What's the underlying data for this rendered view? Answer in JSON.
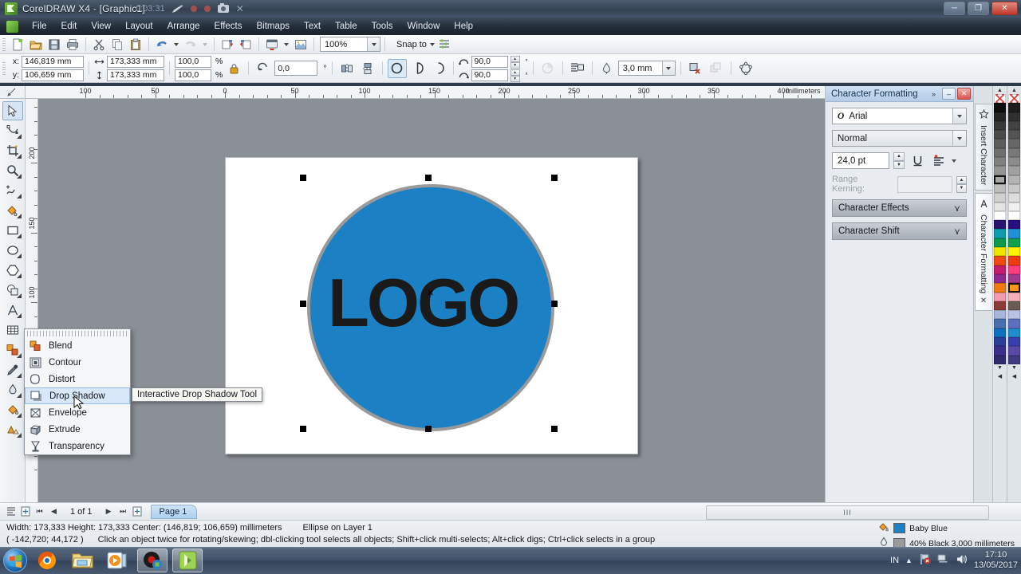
{
  "titlebar": {
    "app_title": "CorelDRAW X4 - [Graphic1]",
    "recorder_time": "0:03:31",
    "icons": [
      "pencil-icon",
      "record-dot-icon",
      "record-dot-icon",
      "camera-icon",
      "close-icon"
    ],
    "minimize": "–",
    "restore": "❐",
    "close": "✕"
  },
  "menubar": {
    "items": [
      "File",
      "Edit",
      "View",
      "Layout",
      "Arrange",
      "Effects",
      "Bitmaps",
      "Text",
      "Table",
      "Tools",
      "Window",
      "Help"
    ]
  },
  "toolbar": {
    "buttons": [
      "new-document",
      "open-document",
      "save-document",
      "print",
      "cut",
      "copy",
      "paste",
      "undo",
      "redo",
      "import",
      "export",
      "application-launcher",
      "corel-online"
    ],
    "zoom_level": "100%",
    "snap_to_label": "Snap to"
  },
  "propertybar": {
    "x_label": "x:",
    "y_label": "y:",
    "x_value": "146,819 mm",
    "y_value": "106,659 mm",
    "width_value": "173,333 mm",
    "height_value": "173,333 mm",
    "scale_h": "100,0",
    "scale_v": "100,0",
    "percent": "%",
    "lock_icon": "lock-icon",
    "rotation_value": "0,0",
    "degree": "°",
    "arc_start": "90,0",
    "arc_end": "90,0",
    "outline_width": "3,0 mm",
    "shape_modes": [
      "ellipse-mode",
      "pie-mode",
      "arc-mode"
    ]
  },
  "rulers": {
    "h_labels": [
      "100",
      "50",
      "0",
      "50",
      "100",
      "150",
      "200",
      "250",
      "300",
      "350",
      "400"
    ],
    "unit": "millimeters",
    "v_labels": [
      "200",
      "150",
      "100"
    ]
  },
  "toolbox": {
    "tools": [
      {
        "name": "pick-tool",
        "selected": true
      },
      {
        "name": "shape-tool",
        "selected": false
      },
      {
        "name": "crop-tool",
        "selected": false
      },
      {
        "name": "zoom-tool",
        "selected": false
      },
      {
        "name": "freehand-tool",
        "selected": false
      },
      {
        "name": "smart-fill-tool",
        "selected": false
      },
      {
        "name": "rectangle-tool",
        "selected": false
      },
      {
        "name": "ellipse-tool",
        "selected": false
      },
      {
        "name": "polygon-tool",
        "selected": false
      },
      {
        "name": "basic-shapes-tool",
        "selected": false
      },
      {
        "name": "text-tool",
        "selected": false
      },
      {
        "name": "table-tool",
        "selected": false
      },
      {
        "name": "interactive-blend-tool",
        "selected": false
      },
      {
        "name": "eyedropper-tool",
        "selected": false
      },
      {
        "name": "outline-tool",
        "selected": false
      },
      {
        "name": "fill-tool",
        "selected": false
      },
      {
        "name": "interactive-fill-tool",
        "selected": false
      }
    ]
  },
  "flyout": {
    "items": [
      {
        "label": "Blend",
        "icon": "blend-icon",
        "highlighted": false
      },
      {
        "label": "Contour",
        "icon": "contour-icon",
        "highlighted": false
      },
      {
        "label": "Distort",
        "icon": "distort-icon",
        "highlighted": false
      },
      {
        "label": "Drop Shadow",
        "icon": "drop-shadow-icon",
        "highlighted": true
      },
      {
        "label": "Envelope",
        "icon": "envelope-icon",
        "highlighted": false
      },
      {
        "label": "Extrude",
        "icon": "extrude-icon",
        "highlighted": false
      },
      {
        "label": "Transparency",
        "icon": "transparency-icon",
        "highlighted": false
      }
    ],
    "tooltip": "Interactive Drop Shadow Tool"
  },
  "canvas": {
    "logo_text": "LOGO",
    "circle_fill": "#1b80c4",
    "circle_outline": "#9a9a9a",
    "page_background": "#ffffff"
  },
  "docker": {
    "title": "Character Formatting",
    "collapse_icon": "»",
    "minimize_icon": "–",
    "close_icon": "✕",
    "font_family": "Arial",
    "font_style": "Normal",
    "font_size": "24,0 pt",
    "underline_icon": "underline-icon",
    "align_icon": "text-align-icon",
    "kerning_label": "Range Kerning:",
    "kerning_value": "",
    "sections": [
      "Character Effects",
      "Character Shift"
    ],
    "tabs": [
      "Insert Character",
      "Character Formatting"
    ],
    "tab_close": "✕"
  },
  "pagebar": {
    "page_counter": "1 of 1",
    "page_tab": "Page 1",
    "nav_first": "⏮",
    "nav_prev": "◀",
    "nav_next": "▶",
    "nav_last": "⏭",
    "add_page_icon": "add-page-icon"
  },
  "statusbar": {
    "dimensions": "Width: 173,333 Height: 173,333 Center: (146,819; 106,659)  millimeters",
    "object_info": "Ellipse on Layer 1",
    "coordinates": "( -142,720; 44,172 )",
    "hint": "Click an object twice for rotating/skewing; dbl-clicking tool selects all objects; Shift+click multi-selects; Alt+click digs; Ctrl+click selects in a group",
    "fill_color_name": "Baby Blue",
    "fill_color_hex": "#1b80c4",
    "outline_color_name": "40% Black  3,000 millimeters",
    "outline_color_hex": "#9a9a9a"
  },
  "taskbar": {
    "start_icon": "windows-start-icon",
    "apps": [
      "firefox-icon",
      "file-explorer-icon",
      "media-player-icon",
      "screen-recorder-icon",
      "coreldraw-icon"
    ],
    "tray_language": "IN",
    "tray_icons": [
      "show-hidden-icon",
      "flag-action-center-icon",
      "network-icon",
      "volume-icon"
    ],
    "time": "17:10",
    "date": "13/05/2017"
  },
  "palette": {
    "column1": [
      "none",
      "#0d0d0d",
      "#262626",
      "#383838",
      "#4a4a4a",
      "#5c5c5c",
      "#6e6e6e",
      "#808080",
      "#949494",
      "#a8a8a8",
      "#bcbcbc",
      "#d0d0d0",
      "#e4e4e4",
      "#ffffff",
      "#2b1370",
      "#0f9bab",
      "#0d9a4e",
      "#f2e600",
      "#ee4b13",
      "#c51b6b",
      "#8e2a8e",
      "#f07a11",
      "#f49ab0",
      "#8d3b36",
      "#a8b6dd",
      "#4a6fb0",
      "#1070c0",
      "#2a3d99",
      "#3b2f8e",
      "#2f2a6b"
    ],
    "column2": [
      "none",
      "#1c1c1c",
      "#303030",
      "#424242",
      "#545454",
      "#666666",
      "#787878",
      "#8c8c8c",
      "#a0a0a0",
      "#b4b4b4",
      "#c8c8c8",
      "#dcdcdc",
      "#f0f0f0",
      "#ffffff",
      "#2a0f80",
      "#1f8fd8",
      "#10a050",
      "#fff200",
      "#ef3b11",
      "#ff3d7f",
      "#a03a8c",
      "#f7931e",
      "#f7b0b8",
      "#6b5b52",
      "#b9c3e6",
      "#5d6fc0",
      "#1f8ccf",
      "#3a3fb0",
      "#5a4aa8",
      "#403a80"
    ]
  }
}
